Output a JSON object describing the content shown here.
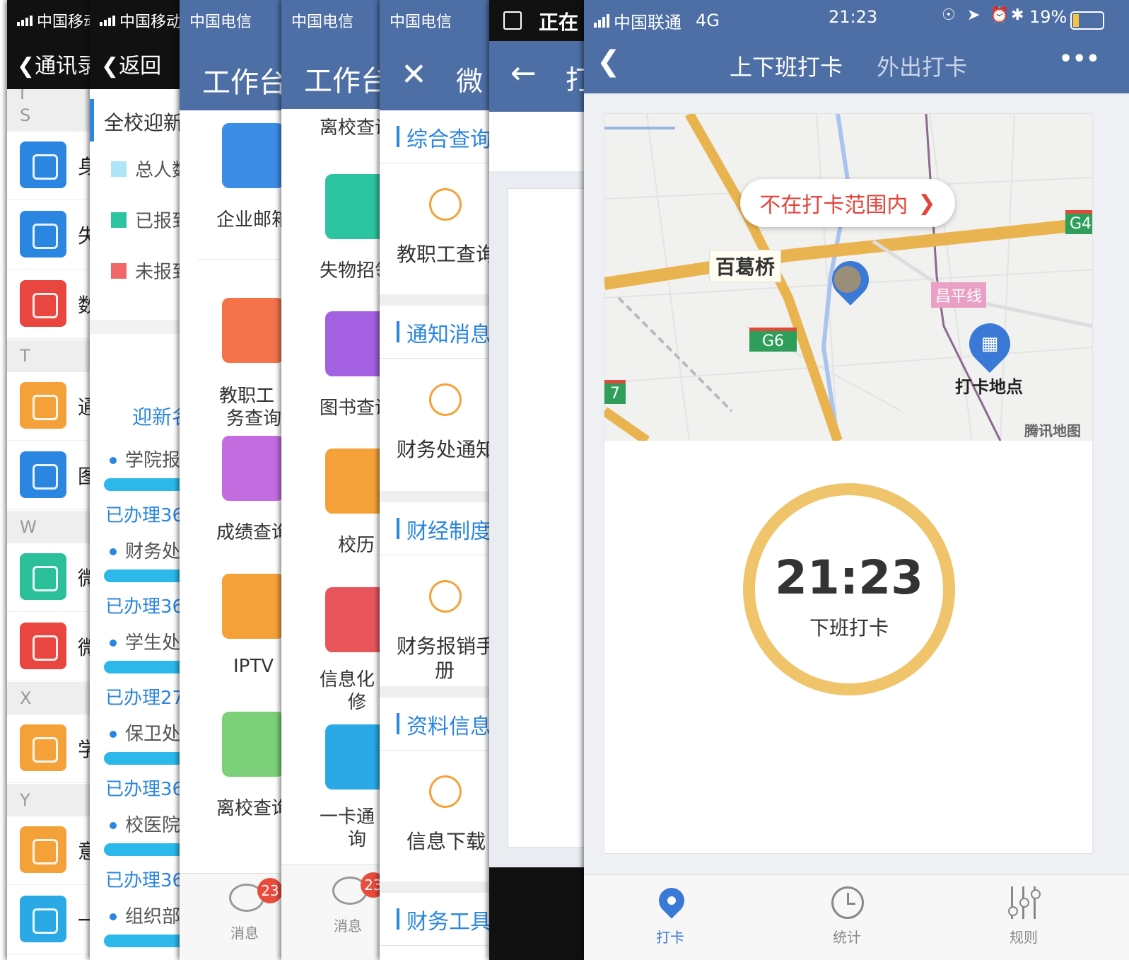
{
  "p1": {
    "carrier": "中国移动",
    "back": "通讯录",
    "sections": [
      "J",
      "S",
      "T",
      "W",
      "X",
      "Y"
    ],
    "items": [
      {
        "char": "身",
        "color": "#2a86e0",
        "icon": "message-icon"
      },
      {
        "char": "失",
        "color": "#2a86e0",
        "icon": "search-doc-icon"
      },
      {
        "char": "数",
        "color": "#e8463f",
        "icon": "chart-icon"
      },
      {
        "char": "通",
        "color": "#f5a13a",
        "icon": "notice-icon"
      },
      {
        "char": "图",
        "color": "#2a86e0",
        "icon": "book-icon"
      },
      {
        "char": "微",
        "color": "#2bbf9a",
        "icon": "edit-icon"
      },
      {
        "char": "微",
        "color": "#e8463f",
        "icon": "list-icon"
      },
      {
        "char": "学",
        "color": "#f5a13a",
        "icon": "student-icon"
      },
      {
        "char": "意",
        "color": "#f5a13a",
        "icon": "feedback-icon"
      },
      {
        "char": "一",
        "color": "#2aa9e6",
        "icon": "card-icon"
      }
    ]
  },
  "p2": {
    "carrier": "中国移动",
    "back": "返回",
    "title": "全校迎新",
    "legend": [
      {
        "label": "总人数",
        "color": "#aee6f8"
      },
      {
        "label": "已报到",
        "color": "#2cc4a0"
      },
      {
        "label": "未报到",
        "color": "#f06767"
      }
    ],
    "section": "迎新名",
    "rows": [
      {
        "name": "学院报",
        "done": "已办理36"
      },
      {
        "name": "财务处",
        "done": "已办理36"
      },
      {
        "name": "学生处",
        "done": "已办理27"
      },
      {
        "name": "保卫处",
        "done": "已办理36"
      },
      {
        "name": "校医院",
        "done": "已办理36"
      },
      {
        "name": "组织部",
        "done": ""
      }
    ]
  },
  "p3": {
    "carrier": "中国电信",
    "title": "工作台",
    "apps": [
      {
        "label": "企业邮箱",
        "color": "#3b8de6",
        "icon": "mail-icon"
      },
      {
        "label": "教职工财务查询",
        "line1": "教职工",
        "line2": "务查询",
        "color": "#f4734a",
        "icon": "money-bag-icon"
      },
      {
        "label": "成绩查询",
        "color": "#c36ce0",
        "icon": "grade-icon"
      },
      {
        "label": "IPTV",
        "color": "#f5a13a",
        "icon": "tv-icon"
      },
      {
        "label": "离校查询",
        "color": "#7cd07a",
        "icon": "graduate-icon"
      }
    ],
    "badge": "23",
    "tab_msg": "消息"
  },
  "p4": {
    "carrier": "中国电信",
    "title": "工作台",
    "apps": [
      {
        "label": "离校查询",
        "color": "",
        "icon": ""
      },
      {
        "label": "失物招领",
        "color": "#2cc4a0",
        "icon": "lost-found-icon"
      },
      {
        "label": "图书查询",
        "color": "#a360e0",
        "icon": "notebook-icon"
      },
      {
        "label": "校历",
        "color": "#f5a13a",
        "icon": "calendar-icon"
      },
      {
        "label": "信息化报修",
        "line1": "信息化",
        "line2": "修",
        "color": "#e8555a",
        "icon": "tools-icon"
      },
      {
        "label": "一卡通查询",
        "line1": "一卡通",
        "line2": "询",
        "color": "#2aa9e6",
        "icon": "card-icon"
      }
    ],
    "badge": "23",
    "tab_msg": "消息"
  },
  "p5": {
    "carrier": "中国电信",
    "title": "微",
    "sections": [
      {
        "title": "综合查询",
        "item": "教职工查询",
        "icon": "yen-search-icon"
      },
      {
        "title": "通知消息",
        "item": "财务处通知",
        "icon": "bell-icon"
      },
      {
        "title": "财经制度",
        "item": "财务报销手册",
        "line1": "财务报销手",
        "line2": "册",
        "icon": "manual-icon"
      },
      {
        "title": "资料信息",
        "item": "信息下载",
        "icon": "download-icon"
      },
      {
        "title": "财务工具",
        "item": "",
        "icon": ""
      }
    ]
  },
  "p6": {
    "status": "正在",
    "title": "打"
  },
  "p7": {
    "carrier": "中国联通",
    "network": "4G",
    "time": "21:23",
    "battery": "19%",
    "tab_active": "上下班打卡",
    "tab_other": "外出打卡",
    "more": "•••",
    "map": {
      "bubble": "不在打卡范围内",
      "place": "百葛桥",
      "g4": "G4",
      "g6": "G6",
      "g7": "7",
      "line": "昌平线",
      "checkin_point": "打卡地点",
      "attribution": "腾讯地图"
    },
    "clock_time": "21:23",
    "clock_label": "下班打卡",
    "bottom_tabs": [
      {
        "label": "打卡",
        "icon": "location-pin-icon",
        "active": true
      },
      {
        "label": "统计",
        "icon": "clock-icon",
        "active": false
      },
      {
        "label": "规则",
        "icon": "sliders-icon",
        "active": false
      }
    ],
    "colors": {
      "header": "#4e6fa6",
      "accent": "#3a79d6",
      "ring": "#f0c46a",
      "warn": "#e2453c"
    }
  }
}
